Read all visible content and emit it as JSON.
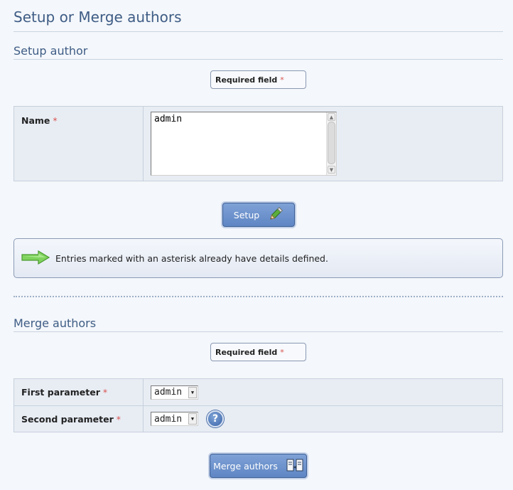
{
  "page": {
    "title": "Setup or Merge authors"
  },
  "setup": {
    "title": "Setup author",
    "required_label": "Required field",
    "asterisk": "*",
    "name_label": "Name",
    "name_value": "admin",
    "button_label": "Setup"
  },
  "info": {
    "message": "Entries marked with an asterisk already have details defined."
  },
  "merge": {
    "title": "Merge authors",
    "required_label": "Required field",
    "asterisk": "*",
    "first_label": "First parameter",
    "first_value": "admin",
    "second_label": "Second parameter",
    "second_value": "admin",
    "help": "?",
    "button_label": "Merge authors"
  },
  "icons": {
    "setup_button": "pencil-icon",
    "merge_button": "merge-icon",
    "info": "arrow-right-icon",
    "help": "help-icon"
  },
  "colors": {
    "title": "#3e5c85",
    "button": "#6a8fcb",
    "asterisk": "#d9534f",
    "arrow": "#6fc44f"
  }
}
